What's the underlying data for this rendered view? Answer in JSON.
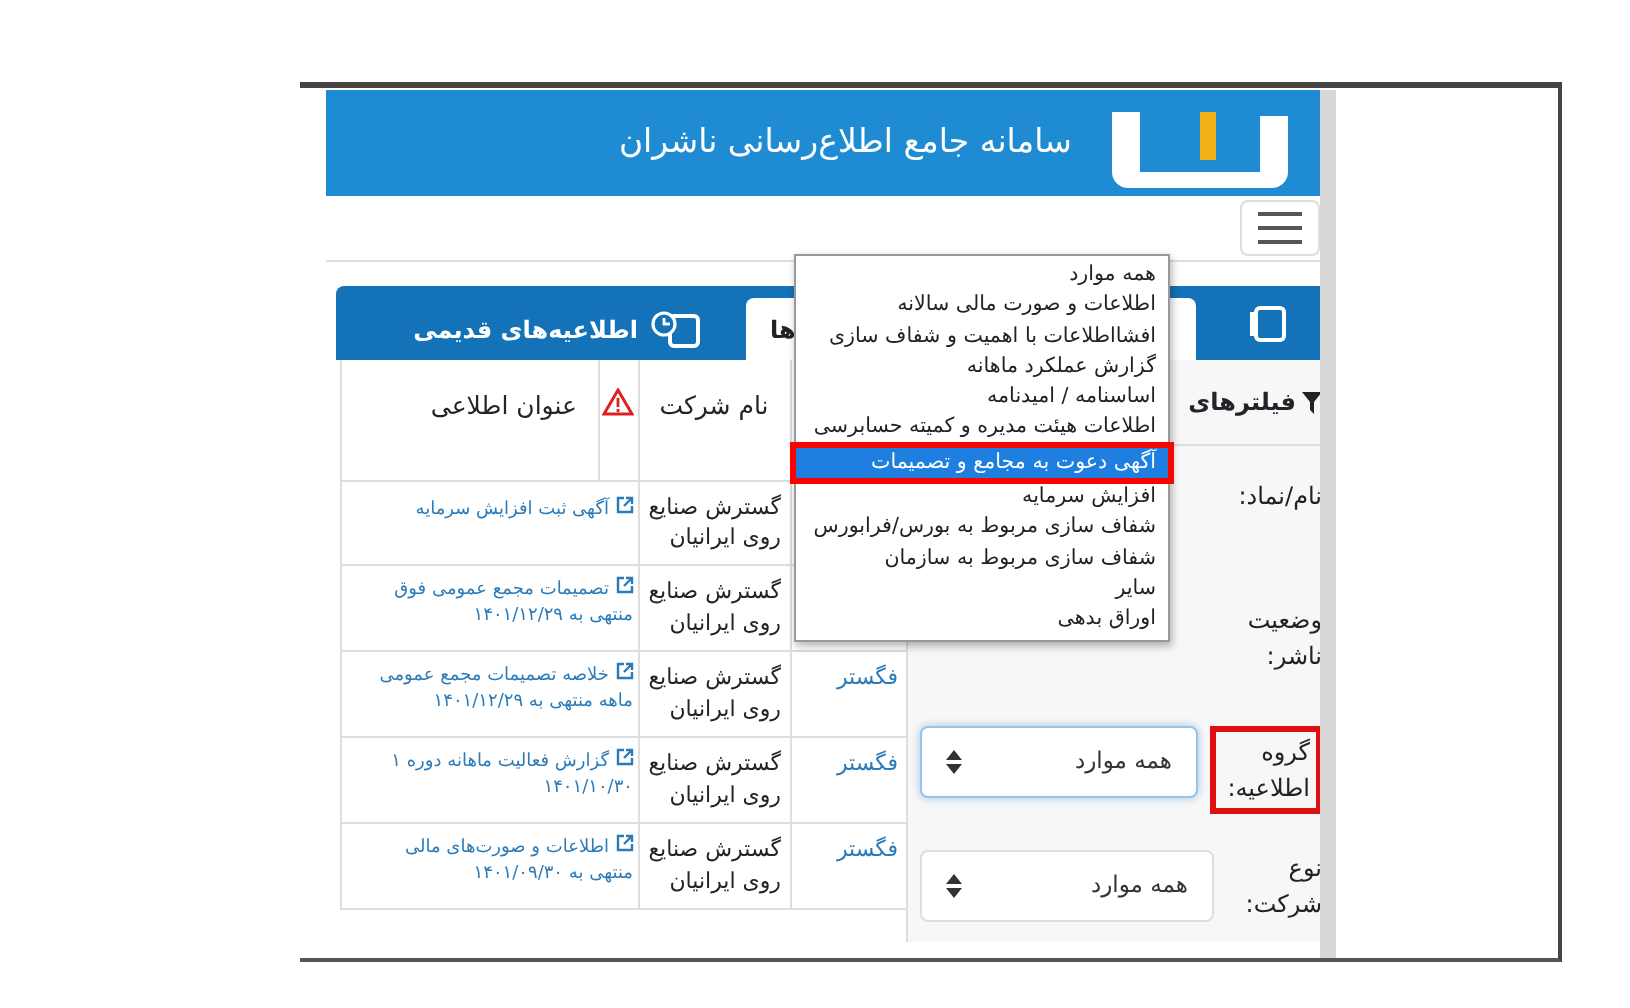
{
  "header": {
    "title": "سامانه جامع اطلاع‌رسانی ناشران"
  },
  "tabs": [
    {
      "label": "ها",
      "selected": true
    },
    {
      "label": "اطلاعیه‌های قدیمی",
      "selected": false
    }
  ],
  "filters": {
    "heading": "فیلترهای",
    "fields": [
      {
        "label": "نام/نماد:",
        "annotated": false
      },
      {
        "label": "وضعیت ناشر:",
        "annotated": false
      },
      {
        "label": "گروه اطلاعیه:",
        "annotated": true,
        "value": "همه موارد",
        "focused": true
      },
      {
        "label": "نوع شرکت:",
        "annotated": false,
        "value": "همه موارد",
        "focused": false
      }
    ]
  },
  "table": {
    "columns": [
      "نام شرکت",
      "عنوان اطلاعی"
    ],
    "rows": [
      {
        "company": "گسترش صنایع روی ایرانیان",
        "title": [
          "آگهی ثبت افزایش سرمایه"
        ]
      },
      {
        "company": "گسترش صنایع روی ایرانیان",
        "title": [
          "تصمیمات مجمع عمومی فوق",
          "منتهی به ۱۴۰۱/۱۲/۲۹"
        ]
      },
      {
        "symbol": "فگستر",
        "company": "گسترش صنایع روی ایرانیان",
        "title": [
          "خلاصه تصمیمات مجمع عمومی",
          "ماهه منتهی به ۱۴۰۱/۱۲/۲۹"
        ]
      },
      {
        "symbol": "فگستر",
        "company": "گسترش صنایع روی ایرانیان",
        "title": [
          "گزارش فعالیت ماهانه دوره ۱",
          "۱۴۰۱/۱۰/۳۰"
        ]
      },
      {
        "symbol": "فگستر",
        "company": "گسترش صنایع روی ایرانیان",
        "title": [
          "اطلاعات و صورت‌های مالی",
          "منتهی به ۱۴۰۱/۰۹/۳۰"
        ]
      }
    ]
  },
  "dropdown": {
    "options": [
      {
        "label": "همه موارد",
        "selected": false
      },
      {
        "label": "اطلاعات و صورت مالی سالانه",
        "selected": false
      },
      {
        "label": "افشااطلاعات با اهمیت و شفاف سازی",
        "selected": false
      },
      {
        "label": "گزارش عملکرد ماهانه",
        "selected": false
      },
      {
        "label": "اساسنامه / امیدنامه",
        "selected": false
      },
      {
        "label": "اطلاعات هیئت مدیره و کمیته حسابرسی",
        "selected": false
      },
      {
        "label": "آگهی دعوت به مجامع و تصمیمات",
        "selected": true
      },
      {
        "label": "افزایش سرمایه",
        "selected": false
      },
      {
        "label": "شفاف سازی مربوط به بورس/فرابورس",
        "selected": false
      },
      {
        "label": "شفاف سازی مربوط به سازمان",
        "selected": false
      },
      {
        "label": "سایر",
        "selected": false
      },
      {
        "label": "اوراق بدهی",
        "selected": false
      }
    ]
  }
}
